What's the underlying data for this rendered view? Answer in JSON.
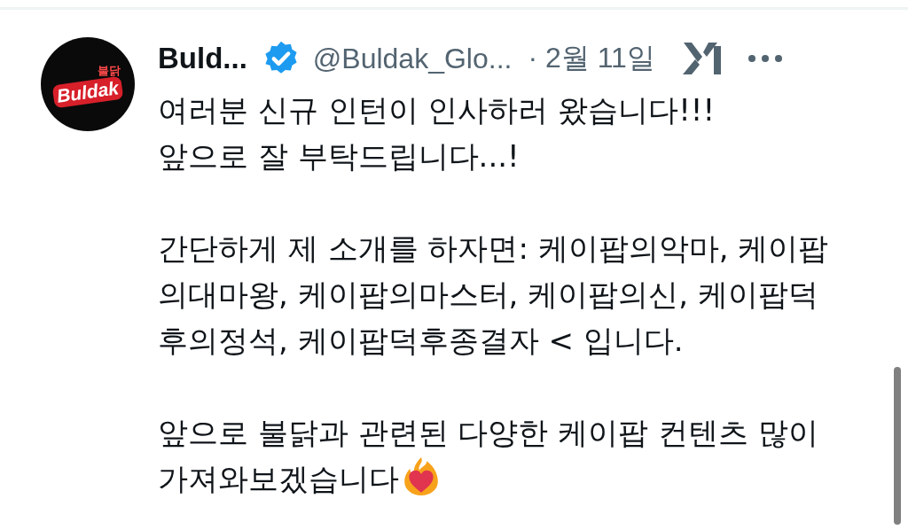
{
  "post": {
    "avatar": {
      "logo_text": "Buldak",
      "logo_subtext": "불닭"
    },
    "author_name": "Buld...",
    "verified": true,
    "handle": "@Buldak_Glo...",
    "date": "· 2월 11일",
    "paragraphs": [
      "여러분 신규 인턴이 인사하러 왔습니다!!!\n앞으로 잘 부탁드립니다...!",
      "간단하게 제 소개를 하자면: 케이팝의악마, 케이팝\n의대마왕, 케이팝의마스터, 케이팝의신, 케이팝덕\n후의정석, 케이팝덕후종결자 < 입니다.",
      "앞으로 불닭과 관련된 다양한 케이팝 컨텐츠 많이\n가져와보겠습니다"
    ]
  }
}
